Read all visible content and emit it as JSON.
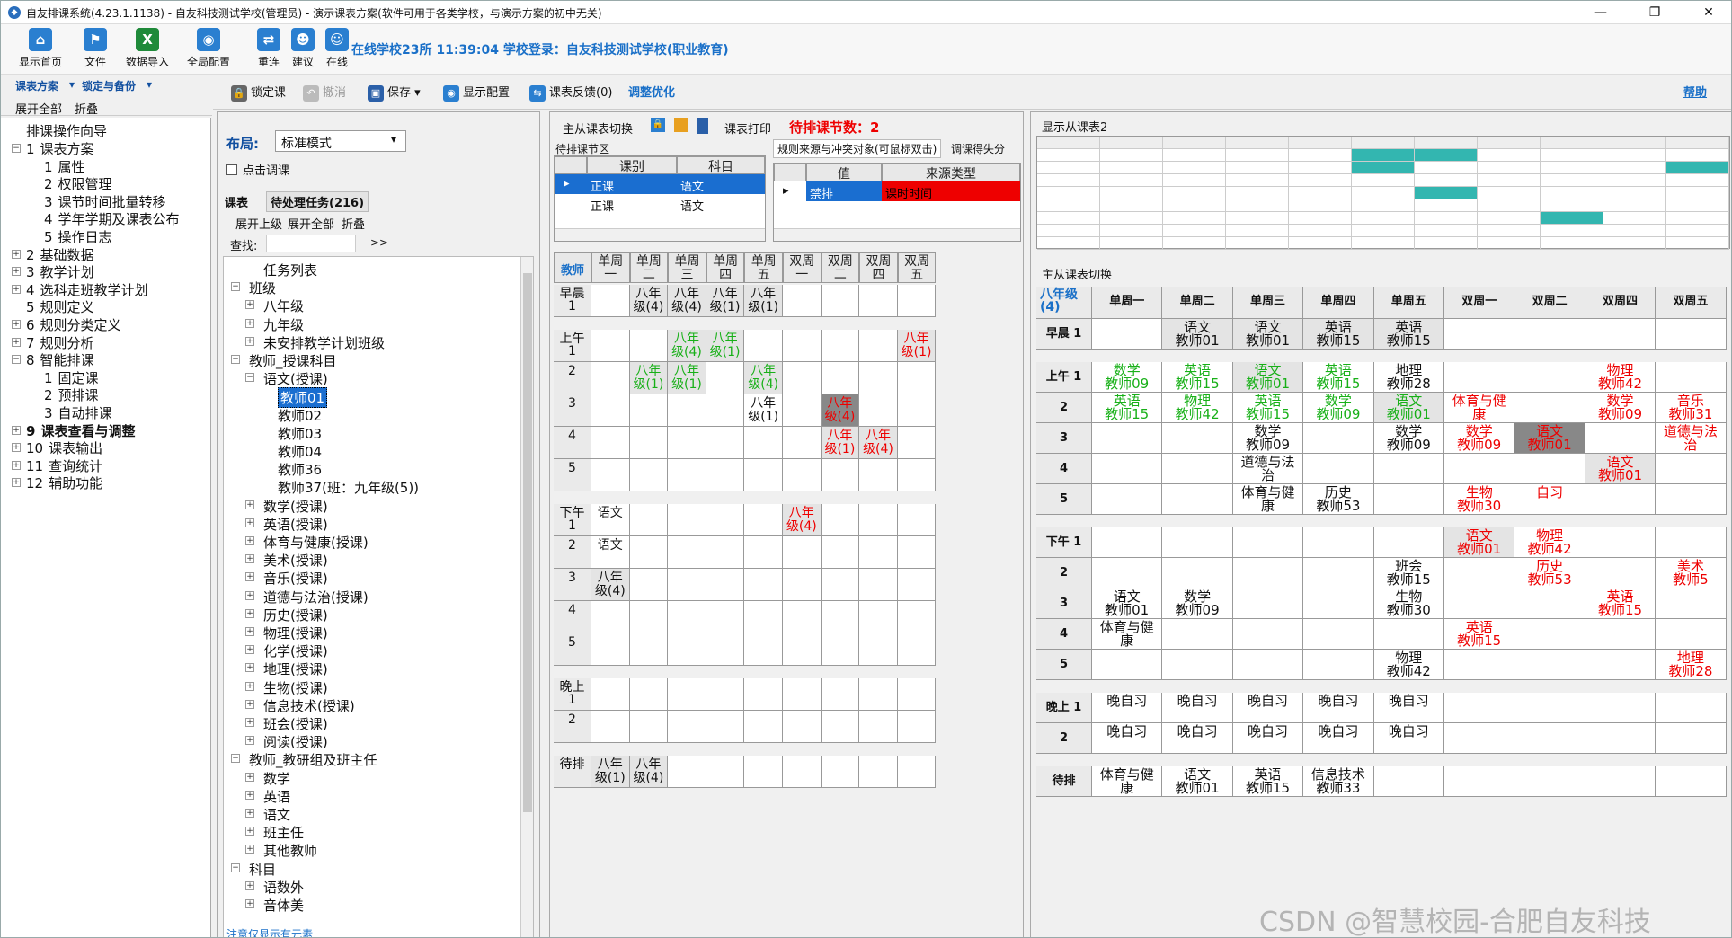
{
  "window": {
    "title": "自友排课系统(4.23.1.1138) - 自友科技测试学校(管理员) - 演示课表方案(软件可用于各类学校，与演示方案的初中无关)",
    "min": "—",
    "restore": "❐",
    "close": "✕"
  },
  "toolbar": {
    "buttons": [
      {
        "label": "显示首页",
        "icon": "home-icon",
        "color": "#2a7fd0"
      },
      {
        "label": "文件",
        "icon": "flag-icon",
        "color": "#2a7fd0"
      },
      {
        "label": "数据导入",
        "icon": "excel-icon",
        "color": "#1f8a3a"
      },
      {
        "label": "全局配置",
        "icon": "eye-icon",
        "color": "#2a7fd0"
      },
      {
        "label": "重连",
        "icon": "reconnect-icon",
        "color": "#2a7fd0"
      },
      {
        "label": "建议",
        "icon": "user-icon",
        "color": "#2a7fd0"
      },
      {
        "label": "在线",
        "icon": "users-icon",
        "color": "#2a7fd0"
      }
    ],
    "status": "在线学校23所    11:39:04 学校登录：自友科技测试学校(职业教育)"
  },
  "menu": {
    "tab1": "课表方案",
    "tab2": "锁定与备份",
    "expand_all": "展开全部",
    "collapse": "折叠"
  },
  "nav": {
    "guide": "排课操作向导",
    "items": [
      {
        "num": "1",
        "label": "课表方案",
        "expanded": true
      },
      {
        "num": "1",
        "label": "属性",
        "child": true
      },
      {
        "num": "2",
        "label": "权限管理",
        "child": true
      },
      {
        "num": "3",
        "label": "课节时间批量转移",
        "child": true
      },
      {
        "num": "4",
        "label": "学年学期及课表公布",
        "child": true
      },
      {
        "num": "5",
        "label": "操作日志",
        "child": true
      },
      {
        "num": "2",
        "label": "基础数据"
      },
      {
        "num": "3",
        "label": "教学计划"
      },
      {
        "num": "4",
        "label": "选科走班教学计划"
      },
      {
        "num": "5",
        "label": "规则定义",
        "noplus": true
      },
      {
        "num": "6",
        "label": "规则分类定义"
      },
      {
        "num": "7",
        "label": "规则分析"
      },
      {
        "num": "8",
        "label": "智能排课",
        "expanded": true
      },
      {
        "num": "1",
        "label": "固定课",
        "child": true
      },
      {
        "num": "2",
        "label": "预排课",
        "child": true
      },
      {
        "num": "3",
        "label": "自动排课",
        "child": true
      },
      {
        "num": "9",
        "label": "课表查看与调整",
        "bold": true
      },
      {
        "num": "10",
        "label": "课表输出"
      },
      {
        "num": "11",
        "label": "查询统计"
      },
      {
        "num": "12",
        "label": "辅助功能"
      }
    ]
  },
  "toolbar2": {
    "lock": "锁定课",
    "undo": "撤消",
    "save": "保存",
    "display": "显示配置",
    "feedback": "课表反馈(0)",
    "optimize": "调整优化",
    "help": "帮助"
  },
  "treepanel": {
    "layout_label": "布局:",
    "layout_value": "标准模式",
    "click_adjust": "点击调课",
    "tab_schedule": "课表",
    "tab_pending": "待处理任务(216)",
    "expand_upper": "展开上级",
    "expand_all": "展开全部",
    "collapse": "折叠",
    "search_label": "查找:",
    "search_go": ">>",
    "nodes": [
      {
        "label": "任务列表",
        "level": 1
      },
      {
        "label": "班级",
        "level": 0,
        "sign": "-"
      },
      {
        "label": "八年级",
        "level": 1,
        "sign": "+"
      },
      {
        "label": "九年级",
        "level": 1,
        "sign": "+"
      },
      {
        "label": "未安排教学计划班级",
        "level": 1,
        "sign": "+"
      },
      {
        "label": "教师_授课科目",
        "level": 0,
        "sign": "-"
      },
      {
        "label": "语文(授课)",
        "level": 1,
        "sign": "-"
      },
      {
        "label": "教师01",
        "level": 2,
        "selected": true
      },
      {
        "label": "教师02",
        "level": 2
      },
      {
        "label": "教师03",
        "level": 2
      },
      {
        "label": "教师04",
        "level": 2
      },
      {
        "label": "教师36",
        "level": 2
      },
      {
        "label": "教师37(班：九年级(5))",
        "level": 2
      },
      {
        "label": "数学(授课)",
        "level": 1,
        "sign": "+"
      },
      {
        "label": "英语(授课)",
        "level": 1,
        "sign": "+"
      },
      {
        "label": "体育与健康(授课)",
        "level": 1,
        "sign": "+"
      },
      {
        "label": "美术(授课)",
        "level": 1,
        "sign": "+"
      },
      {
        "label": "音乐(授课)",
        "level": 1,
        "sign": "+"
      },
      {
        "label": "道德与法治(授课)",
        "level": 1,
        "sign": "+"
      },
      {
        "label": "历史(授课)",
        "level": 1,
        "sign": "+"
      },
      {
        "label": "物理(授课)",
        "level": 1,
        "sign": "+"
      },
      {
        "label": "化学(授课)",
        "level": 1,
        "sign": "+"
      },
      {
        "label": "地理(授课)",
        "level": 1,
        "sign": "+"
      },
      {
        "label": "生物(授课)",
        "level": 1,
        "sign": "+"
      },
      {
        "label": "信息技术(授课)",
        "level": 1,
        "sign": "+"
      },
      {
        "label": "班会(授课)",
        "level": 1,
        "sign": "+"
      },
      {
        "label": "阅读(授课)",
        "level": 1,
        "sign": "+"
      },
      {
        "label": "教师_教研组及班主任",
        "level": 0,
        "sign": "-"
      },
      {
        "label": "数学",
        "level": 1,
        "sign": "+"
      },
      {
        "label": "英语",
        "level": 1,
        "sign": "+"
      },
      {
        "label": "语文",
        "level": 1,
        "sign": "+"
      },
      {
        "label": "班主任",
        "level": 1,
        "sign": "+"
      },
      {
        "label": "其他教师",
        "level": 1,
        "sign": "+"
      },
      {
        "label": "科目",
        "level": 0,
        "sign": "-"
      },
      {
        "label": "语数外",
        "level": 1,
        "sign": "+"
      },
      {
        "label": "音体美",
        "level": 1,
        "sign": "+"
      }
    ],
    "footer": "注意仅显示有元素"
  },
  "mid": {
    "switch": "主从课表切换",
    "print": "课表打印",
    "pending_count": "待排课节数：2",
    "pending_area": "待排课节区",
    "pending_headers": [
      "课别",
      "科目"
    ],
    "pending_rows": [
      [
        "正课",
        "语文"
      ],
      [
        "正课",
        "语文"
      ]
    ],
    "conflict_tab": "规则来源与冲突对象(可鼠标双击)",
    "cost_tab": "调课得失分",
    "conflict_headers": [
      "值",
      "来源类型"
    ],
    "conflict_rows": [
      [
        "禁排",
        "课时时间"
      ]
    ],
    "corner": "教师",
    "days": [
      "单周一",
      "单周二",
      "单周三",
      "单周四",
      "单周五",
      "双周一",
      "双周二",
      "双周四",
      "双周五"
    ],
    "rows": [
      {
        "label": "早晨\n1",
        "cells": [
          "",
          "八年\n级(4)",
          "八年\n级(4)",
          "八年\n级(1)",
          "八年\n级(1)",
          "",
          "",
          "",
          ""
        ]
      },
      {
        "label": "上午\n1",
        "cells": [
          "",
          "",
          "八年\n级(4)",
          "八年\n级(1)",
          "",
          "",
          "",
          "",
          "八年\n级(1)"
        ]
      },
      {
        "label": "2",
        "cells": [
          "",
          "八年\n级(1)",
          "八年\n级(1)",
          "",
          "八年\n级(4)",
          "",
          "",
          "",
          ""
        ]
      },
      {
        "label": "3",
        "cells": [
          "",
          "",
          "",
          "",
          "八年\n级(1)",
          "",
          "八年\n级(4)",
          "",
          ""
        ]
      },
      {
        "label": "4",
        "cells": [
          "",
          "",
          "",
          "",
          "",
          "",
          "八年\n级(1)",
          "八年\n级(4)",
          ""
        ]
      },
      {
        "label": "5",
        "cells": [
          "",
          "",
          "",
          "",
          "",
          "",
          "",
          "",
          ""
        ]
      },
      {
        "label": "下午\n1",
        "cells": [
          "语文",
          "",
          "",
          "",
          "",
          "八年\n级(4)",
          "",
          "",
          ""
        ]
      },
      {
        "label": "2",
        "cells": [
          "语文",
          "",
          "",
          "",
          "",
          "",
          "",
          "",
          ""
        ]
      },
      {
        "label": "3",
        "cells": [
          "八年\n级(4)",
          "",
          "",
          "",
          "",
          "",
          "",
          "",
          ""
        ]
      },
      {
        "label": "4",
        "cells": [
          "",
          "",
          "",
          "",
          "",
          "",
          "",
          "",
          ""
        ]
      },
      {
        "label": "5",
        "cells": [
          "",
          "",
          "",
          "",
          "",
          "",
          "",
          "",
          ""
        ]
      },
      {
        "label": "晚上\n1",
        "cells": [
          "",
          "",
          "",
          "",
          "",
          "",
          "",
          "",
          ""
        ]
      },
      {
        "label": "2",
        "cells": [
          "",
          "",
          "",
          "",
          "",
          "",
          "",
          "",
          ""
        ]
      },
      {
        "label": "待排",
        "cells": [
          "八年\n级(1)",
          "八年\n级(4)",
          "",
          "",
          "",
          "",
          "",
          "",
          ""
        ]
      }
    ]
  },
  "right": {
    "mini_title": "显示从课表2",
    "switch": "主从课表切换",
    "class_select": "八年级(4)",
    "days": [
      "单周一",
      "单周二",
      "单周三",
      "单周四",
      "单周五",
      "双周一",
      "双周二",
      "双周四",
      "双周五"
    ],
    "rows": [
      {
        "label": "早晨 1",
        "cells": [
          "",
          "语文\n教师01",
          "语文\n教师01",
          "英语\n教师15",
          "英语\n教师15",
          "",
          "",
          "",
          ""
        ]
      },
      {
        "label": "上午 1",
        "cells": [
          "数学\n教师09",
          "英语\n教师15",
          "语文\n教师01",
          "英语\n教师15",
          "地理\n教师28",
          "",
          "",
          "物理\n教师42",
          ""
        ]
      },
      {
        "label": "2",
        "cells": [
          "英语\n教师15",
          "物理\n教师42",
          "英语\n教师15",
          "数学\n教师09",
          "语文\n教师01",
          "体育与健\n康",
          "",
          "数学\n教师09",
          "音乐\n教师31"
        ]
      },
      {
        "label": "3",
        "cells": [
          "",
          "",
          "数学\n教师09",
          "",
          "数学\n教师09",
          "数学\n教师09",
          "语文\n教师01",
          "",
          "道德与法\n治"
        ]
      },
      {
        "label": "4",
        "cells": [
          "",
          "",
          "道德与法\n治",
          "",
          "",
          "",
          "",
          "语文\n教师01",
          ""
        ]
      },
      {
        "label": "5",
        "cells": [
          "",
          "",
          "体育与健\n康",
          "历史\n教师53",
          "",
          "生物\n教师30",
          "自习",
          "",
          ""
        ]
      },
      {
        "label": "下午 1",
        "cells": [
          "",
          "",
          "",
          "",
          "",
          "语文\n教师01",
          "物理\n教师42",
          "",
          ""
        ]
      },
      {
        "label": "2",
        "cells": [
          "",
          "",
          "",
          "",
          "班会\n教师15",
          "",
          "历史\n教师53",
          "",
          "美术\n教师5"
        ]
      },
      {
        "label": "3",
        "cells": [
          "语文\n教师01",
          "数学\n教师09",
          "",
          "",
          "生物\n教师30",
          "",
          "",
          "英语\n教师15",
          ""
        ]
      },
      {
        "label": "4",
        "cells": [
          "体育与健\n康",
          "",
          "",
          "",
          "",
          "英语\n教师15",
          "",
          "",
          ""
        ]
      },
      {
        "label": "5",
        "cells": [
          "",
          "",
          "",
          "",
          "物理\n教师42",
          "",
          "",
          "",
          "地理\n教师28"
        ]
      },
      {
        "label": "晚上 1",
        "cells": [
          "晚自习",
          "晚自习",
          "晚自习",
          "晚自习",
          "晚自习",
          "",
          "",
          "",
          ""
        ]
      },
      {
        "label": "2",
        "cells": [
          "晚自习",
          "晚自习",
          "晚自习",
          "晚自习",
          "晚自习",
          "",
          "",
          "",
          ""
        ]
      },
      {
        "label": "待排",
        "cells": [
          "体育与健\n康",
          "语文\n教师01",
          "英语\n教师15",
          "信息技术\n教师33",
          "",
          "",
          "",
          "",
          ""
        ]
      }
    ]
  },
  "watermark": "CSDN @智慧校园-合肥自友科技"
}
